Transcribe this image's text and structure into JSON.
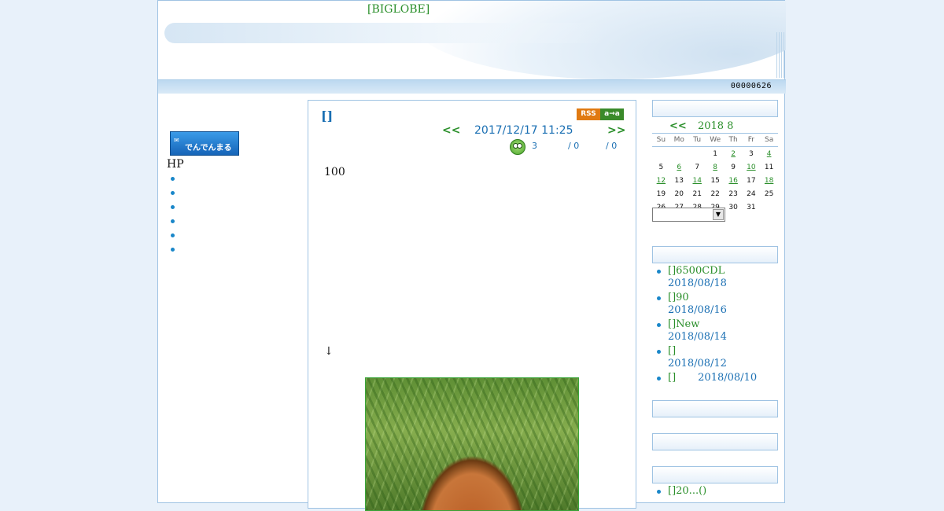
{
  "header": {
    "site_title": "[BIGLOBE]",
    "counter": "00000626"
  },
  "left": {
    "banner_text": "でんでんまる",
    "hp_label": "HP",
    "link_count": 6
  },
  "post": {
    "title": "[]",
    "rss_label": "RSS",
    "rss_alt": "a→a",
    "nav_prev": "<<",
    "nav_next": ">>",
    "date": "2017/12/17 11:25",
    "stat_1": "3",
    "stat_2": "/ 0",
    "stat_3": "/ 0",
    "body_line_1": "100",
    "body_line_2": "↓"
  },
  "calendar": {
    "prev": "<<",
    "month_label": "2018 8",
    "weekdays": [
      "Su",
      "Mo",
      "Tu",
      "We",
      "Th",
      "Fr",
      "Sa"
    ],
    "weeks": [
      [
        "",
        "",
        "",
        "1",
        "2",
        "3",
        "4"
      ],
      [
        "5",
        "6",
        "7",
        "8",
        "9",
        "10",
        "11"
      ],
      [
        "12",
        "13",
        "14",
        "15",
        "16",
        "17",
        "18"
      ],
      [
        "19",
        "20",
        "21",
        "22",
        "23",
        "24",
        "25"
      ],
      [
        "26",
        "27",
        "28",
        "29",
        "30",
        "31",
        ""
      ]
    ],
    "linked_days": [
      "2",
      "4",
      "6",
      "8",
      "10",
      "12",
      "14",
      "16",
      "18"
    ],
    "select_value": ""
  },
  "recent": [
    {
      "title": "[]6500CDL",
      "date": "2018/08/18"
    },
    {
      "title": "[]90",
      "date": "2018/08/16"
    },
    {
      "title": "[]New",
      "date": "2018/08/14"
    },
    {
      "title": "[]",
      "date": "2018/08/12"
    },
    {
      "title": "[]",
      "date": "2018/08/10"
    }
  ],
  "last_item": "[]20...()",
  "colors": {
    "link_green": "#2a8f2a",
    "accent_blue": "#1a6fb3",
    "border_blue": "#9fc3e3",
    "page_bg": "#e8f1fa"
  }
}
